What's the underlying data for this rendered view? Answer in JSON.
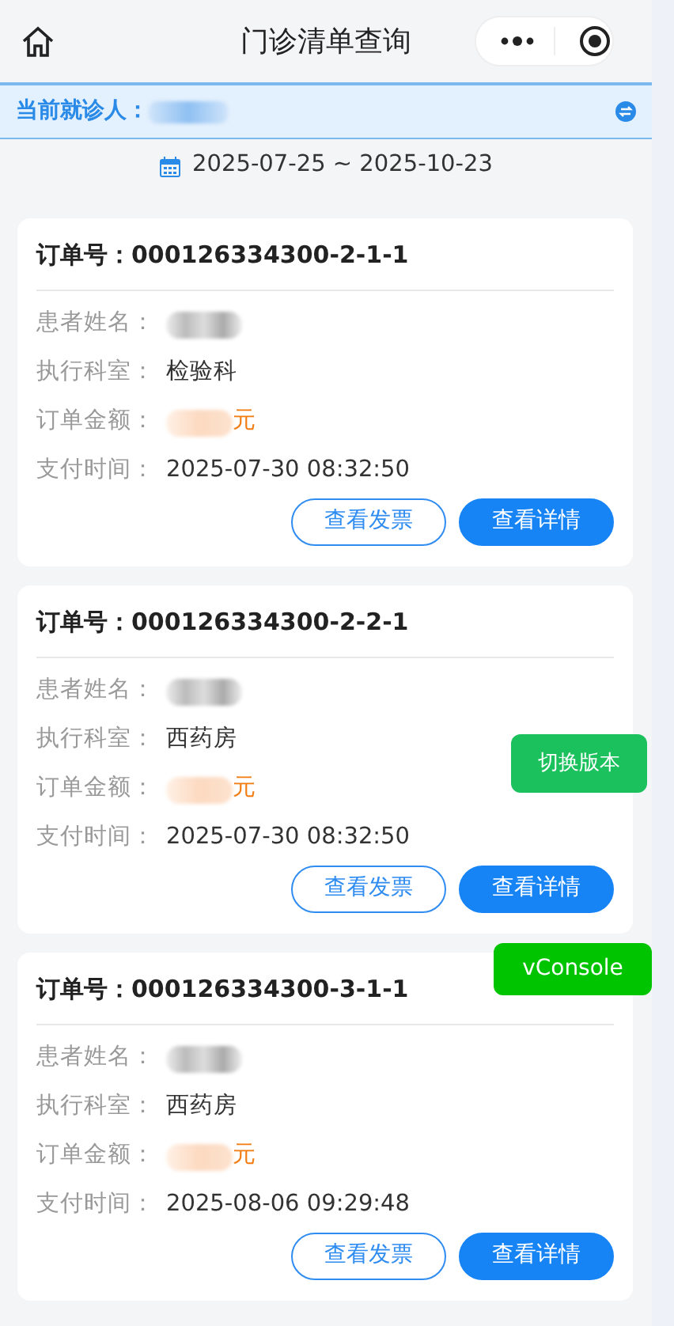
{
  "nav": {
    "title": "门诊清单查询"
  },
  "patient_bar": {
    "label": "当前就诊人：",
    "name_redacted": true
  },
  "date_range": "2025-07-25 ~ 2025-10-23",
  "orders": [
    {
      "title": "订单号：000126334300-2-1-1",
      "fields": [
        {
          "kind": "redacted",
          "label": "患者姓名："
        },
        {
          "kind": "text",
          "label": "执行科室：",
          "value": "检验科"
        },
        {
          "kind": "amount",
          "label": "订单金额：",
          "suffix": "元"
        },
        {
          "kind": "text",
          "label": "支付时间：",
          "value": "2025-07-30 08:32:50"
        }
      ],
      "buttons": [
        "查看发票",
        "查看详情"
      ]
    },
    {
      "title": "订单号：000126334300-2-2-1",
      "fields": [
        {
          "kind": "redacted",
          "label": "患者姓名："
        },
        {
          "kind": "text",
          "label": "执行科室：",
          "value": "西药房"
        },
        {
          "kind": "amount",
          "label": "订单金额：",
          "suffix": "元"
        },
        {
          "kind": "text",
          "label": "支付时间：",
          "value": "2025-07-30 08:32:50"
        }
      ],
      "buttons": [
        "查看发票",
        "查看详情"
      ]
    },
    {
      "title": "订单号：000126334300-3-1-1",
      "fields": [
        {
          "kind": "redacted",
          "label": "患者姓名："
        },
        {
          "kind": "text",
          "label": "执行科室：",
          "value": "西药房"
        },
        {
          "kind": "amount",
          "label": "订单金额：",
          "suffix": "元"
        },
        {
          "kind": "text",
          "label": "支付时间：",
          "value": "2025-08-06 09:29:48"
        }
      ],
      "buttons": [
        "查看发票",
        "查看详情"
      ]
    }
  ],
  "floating": {
    "switch_version": "切换版本",
    "vconsole": "vConsole"
  }
}
